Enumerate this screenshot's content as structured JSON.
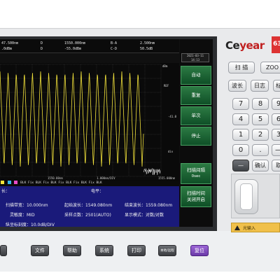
{
  "header": {
    "row1": [
      "47.500nm",
      "D",
      "1550.000nm",
      "B-A",
      "2.500nm"
    ],
    "row2": [
      ".0dBm",
      "D",
      "-55.0dBm",
      "C-D",
      "50.5dB"
    ]
  },
  "datetime": [
    "2021-03-11",
    "14:13"
  ],
  "plot": {
    "right_labels": [
      "dBm",
      "REF",
      "-41.0",
      "div",
      "-81.0"
    ],
    "scale_labels": [
      "1550.00nm",
      "1.000nm/DIV",
      "1555.000nm"
    ]
  },
  "legend": "BLK Fix BLK Fix BLK Fix BLK Fix BLK Fix BLK",
  "softkeys": {
    "auto": "自动",
    "repeat": "重复",
    "single": "单次",
    "stop": "停止",
    "sweep_interval": "扫描间隔",
    "sweep_interval_value": "0sec",
    "sweep_time_line1": "扫描时间",
    "sweep_time_line2": "关闭开启"
  },
  "info": {
    "wavelength_label": "长：",
    "level_label": "电平：",
    "scan_bandwidth": "扫描带宽：10.000nm",
    "start_wavelength": "起始波长：1549.080nm",
    "end_wavelength": "结束波长：1559.080nm",
    "sensitivity": "灵敏度：MID",
    "sample_points": "采样点数：2501(AUTO)",
    "display_mode": "显示模式：对数/对数",
    "scale": "纵坐标刻度：10.0dB/DIV"
  },
  "brand": {
    "name_a": "Ce",
    "name_b": "year",
    "model": "63"
  },
  "panel_buttons": {
    "scan": "扫 描",
    "zoom": "ZOO",
    "wavelength": "波长",
    "log": "日志",
    "mark": "标",
    "n7": "7",
    "n8": "8",
    "n9": "9",
    "n4": "4",
    "n5": "5",
    "n6": "6",
    "n1": "1",
    "n2": "2",
    "n3": "3",
    "n0": "0",
    "dot": ".",
    "dash": "—",
    "minus": "—",
    "confirm": "确认",
    "cancel": "取"
  },
  "warning": "光输入",
  "function_keys": {
    "file": "文件",
    "help": "帮助",
    "system": "系统",
    "print": "打印",
    "local": "本地/远程",
    "reset": "复位"
  },
  "colors": {
    "trace": "#f2e23a",
    "softkey": "#1e6b3a",
    "reset": "#7c47bb"
  }
}
